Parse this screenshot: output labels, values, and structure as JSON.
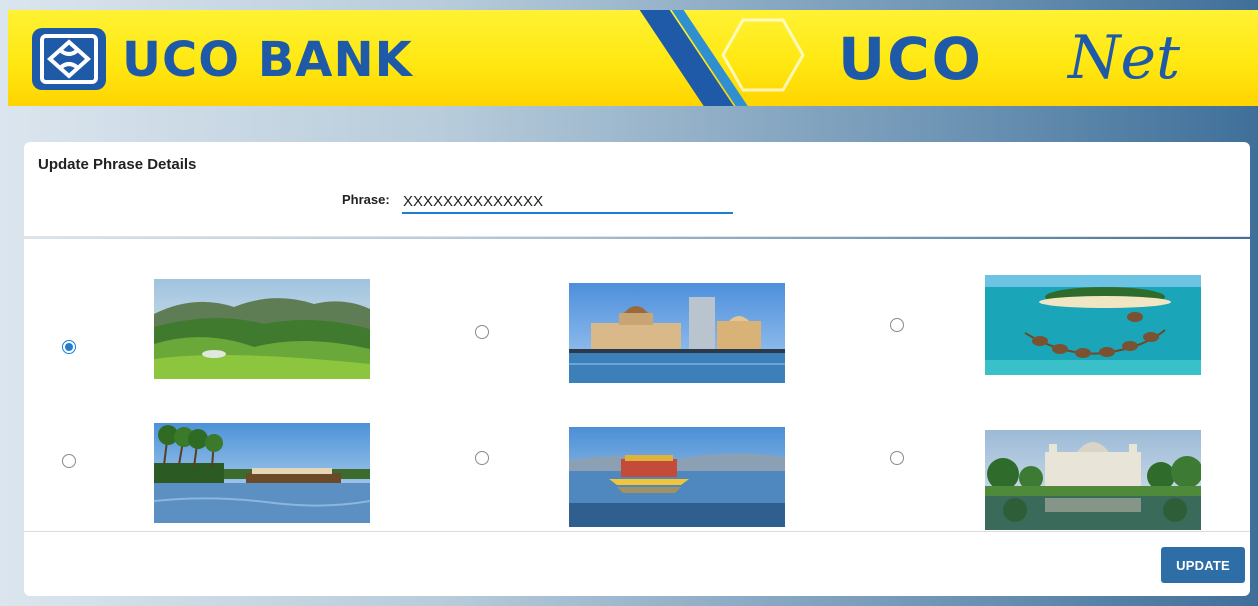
{
  "header": {
    "bank_name": "UCO BANK",
    "net_bold": "UCO",
    "net_italic": "Net"
  },
  "form": {
    "section_title": "Update Phrase Details",
    "phrase_label": "Phrase:",
    "phrase_value": "XXXXXXXXXXXXXX"
  },
  "images": [
    {
      "icon": "hill-station-image",
      "selected": true
    },
    {
      "icon": "gateway-of-india-image",
      "selected": false
    },
    {
      "icon": "island-resort-image",
      "selected": false
    },
    {
      "icon": "kerala-backwaters-image",
      "selected": false
    },
    {
      "icon": "dal-lake-shikara-image",
      "selected": false
    },
    {
      "icon": "victoria-memorial-image",
      "selected": false
    }
  ],
  "footer": {
    "update_label": "UPDATE"
  },
  "colors": {
    "brand_blue": "#1f5aa8",
    "banner_yellow": "#ffe812",
    "accent_blue": "#1c7fd6",
    "button_blue": "#2e6ea6"
  }
}
